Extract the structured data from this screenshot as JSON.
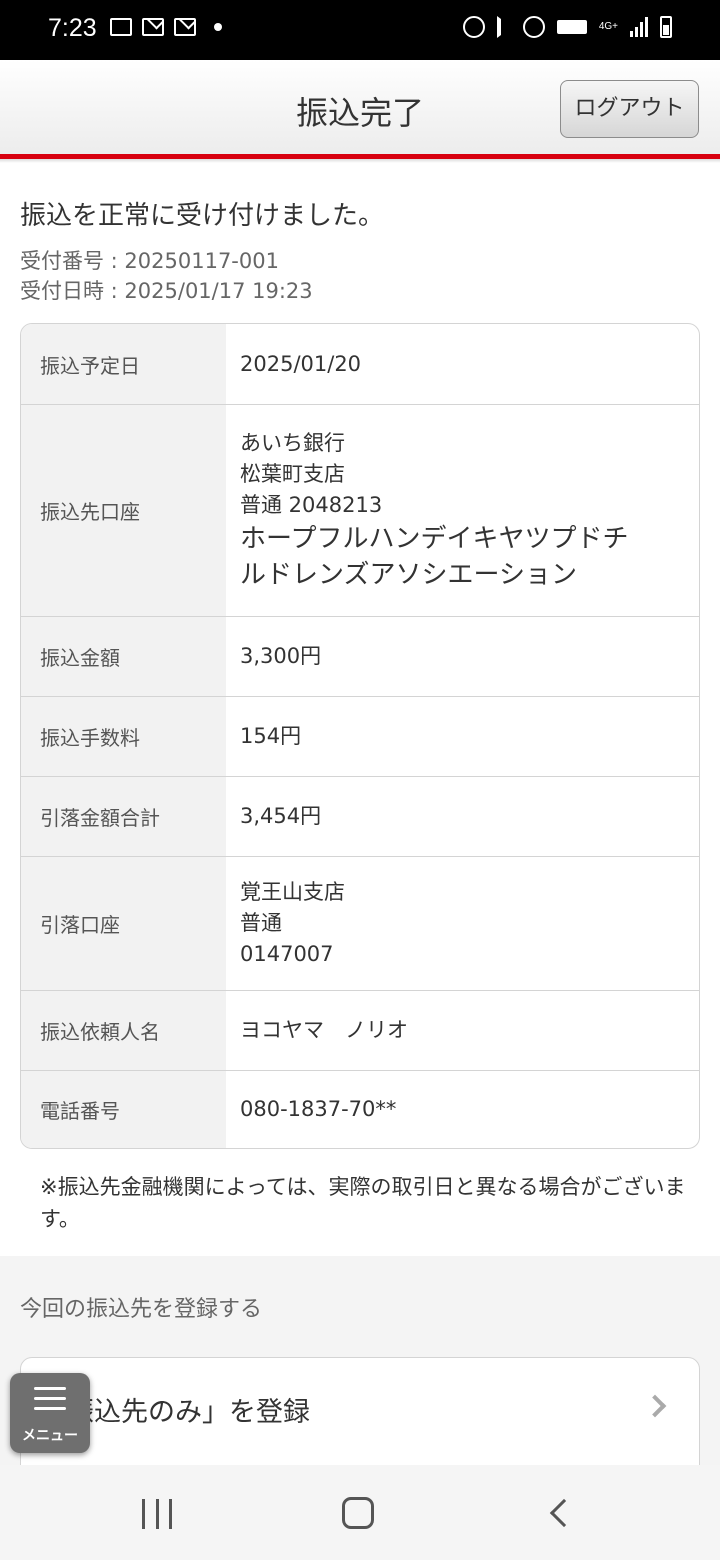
{
  "status_bar": {
    "time": "7:23",
    "network_label": "4G+"
  },
  "header": {
    "title": "振込完了",
    "logout_label": "ログアウト"
  },
  "result": {
    "message": "振込を正常に受け付けました。",
    "reception_number": "受付番号 : 20250117-001",
    "reception_datetime": "受付日時 : 2025/01/17 19:23"
  },
  "details": [
    {
      "label": "振込予定日",
      "lines": [
        "2025/01/20"
      ]
    },
    {
      "label": "振込先口座",
      "lines": [
        "あいち銀行",
        "松葉町支店",
        "普通 2048213"
      ],
      "big_lines": [
        "ホープフルハンデイキヤツプドチ",
        "ルドレンズアソシエーション"
      ]
    },
    {
      "label": "振込金額",
      "lines": [
        "3,300円"
      ]
    },
    {
      "label": "振込手数料",
      "lines": [
        "154円"
      ]
    },
    {
      "label": "引落金額合計",
      "lines": [
        "3,454円"
      ]
    },
    {
      "label": "引落口座",
      "lines": [
        "覚王山支店",
        "普通",
        "0147007"
      ]
    },
    {
      "label": "振込依頼人名",
      "lines": [
        "ヨコヤマ　ノリオ"
      ]
    },
    {
      "label": "電話番号",
      "lines": [
        "080-1837-70**"
      ]
    }
  ],
  "note": "※振込先金融機関によっては、実際の取引日と異なる場合がございます。",
  "register": {
    "section_title": "今回の振込先を登録する",
    "button_label": "「振込先のみ」を登録"
  },
  "menu": {
    "label": "メニュー"
  }
}
